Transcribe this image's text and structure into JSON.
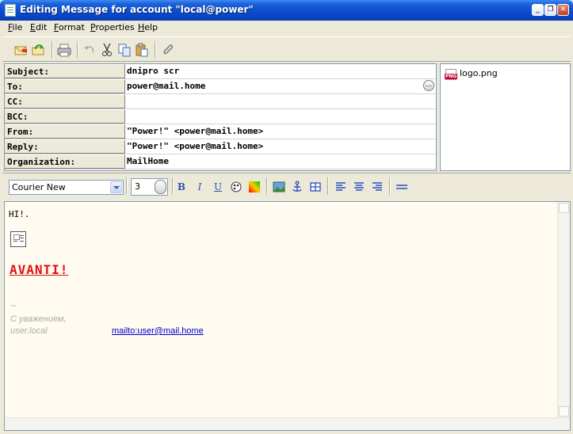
{
  "window": {
    "title": "Editing Message for account \"local@power\""
  },
  "menu": [
    "File",
    "Edit",
    "Format",
    "Properties",
    "Help"
  ],
  "headers": [
    {
      "label": "Subject:",
      "value": "dnipro scr"
    },
    {
      "label": "To:",
      "value": "power@mail.home"
    },
    {
      "label": "CC:",
      "value": ""
    },
    {
      "label": "BCC:",
      "value": ""
    },
    {
      "label": "From:",
      "value": "\"Power!\" <power@mail.home>"
    },
    {
      "label": "Reply:",
      "value": "\"Power!\" <power@mail.home>"
    },
    {
      "label": "Organization:",
      "value": "MailHome"
    }
  ],
  "attachments": [
    {
      "name": "logo.png"
    }
  ],
  "format": {
    "font": "Courier New",
    "size": "3",
    "bold": "B",
    "italic": "I",
    "underline": "U"
  },
  "body": {
    "greeting": "HI!.",
    "headline": "AVANTI!",
    "sig_dash": "--",
    "sig_line1": "С уважением,",
    "sig_line2": " user.local",
    "link": "mailto:user@mail.home"
  }
}
